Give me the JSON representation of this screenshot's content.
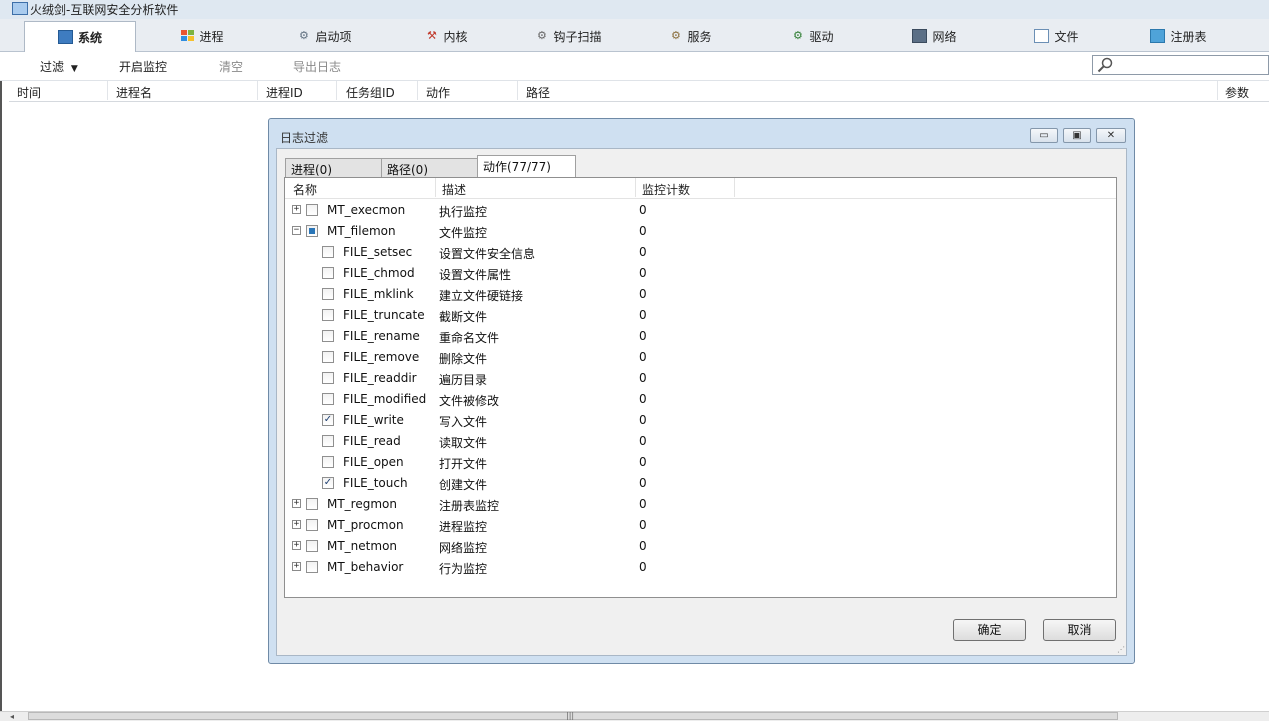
{
  "window": {
    "title": "火绒剑-互联网安全分析软件"
  },
  "tabs": [
    {
      "label": "系统",
      "icon": "monitor-icon",
      "active": true
    },
    {
      "label": "进程",
      "icon": "windows-flag-icon"
    },
    {
      "label": "启动项",
      "icon": "gear-icon"
    },
    {
      "label": "内核",
      "icon": "kernel-tool-icon"
    },
    {
      "label": "钩子扫描",
      "icon": "hook-scan-icon"
    },
    {
      "label": "服务",
      "icon": "service-gear-icon"
    },
    {
      "label": "驱动",
      "icon": "driver-icon"
    },
    {
      "label": "网络",
      "icon": "network-icon"
    },
    {
      "label": "文件",
      "icon": "file-icon"
    },
    {
      "label": "注册表",
      "icon": "registry-icon"
    }
  ],
  "toolbar": {
    "filter": "过滤",
    "filter_arrow": "▼",
    "start_monitor": "开启监控",
    "clear": "清空",
    "export_log": "导出日志",
    "search_value": ""
  },
  "columns": [
    "时间",
    "进程名",
    "进程ID",
    "任务组ID",
    "动作",
    "路径",
    "参数"
  ],
  "dialog": {
    "title": "日志过滤",
    "tabs": [
      "进程(0)",
      "路径(0)",
      "动作(77/77)"
    ],
    "tree_headers": [
      "名称",
      "描述",
      "监控计数"
    ],
    "rows": [
      {
        "name": "MT_execmon",
        "desc": "执行监控",
        "count": "0",
        "level": 0,
        "expander": "+",
        "check": ""
      },
      {
        "name": "MT_filemon",
        "desc": "文件监控",
        "count": "0",
        "level": 0,
        "expander": "-",
        "check": "partial"
      },
      {
        "name": "FILE_setsec",
        "desc": "设置文件安全信息",
        "count": "0",
        "level": 1,
        "check": ""
      },
      {
        "name": "FILE_chmod",
        "desc": "设置文件属性",
        "count": "0",
        "level": 1,
        "check": ""
      },
      {
        "name": "FILE_mklink",
        "desc": "建立文件硬链接",
        "count": "0",
        "level": 1,
        "check": ""
      },
      {
        "name": "FILE_truncate",
        "desc": "截断文件",
        "count": "0",
        "level": 1,
        "check": ""
      },
      {
        "name": "FILE_rename",
        "desc": "重命名文件",
        "count": "0",
        "level": 1,
        "check": ""
      },
      {
        "name": "FILE_remove",
        "desc": "删除文件",
        "count": "0",
        "level": 1,
        "check": ""
      },
      {
        "name": "FILE_readdir",
        "desc": "遍历目录",
        "count": "0",
        "level": 1,
        "check": ""
      },
      {
        "name": "FILE_modified",
        "desc": "文件被修改",
        "count": "0",
        "level": 1,
        "check": ""
      },
      {
        "name": "FILE_write",
        "desc": "写入文件",
        "count": "0",
        "level": 1,
        "check": "✓"
      },
      {
        "name": "FILE_read",
        "desc": "读取文件",
        "count": "0",
        "level": 1,
        "check": ""
      },
      {
        "name": "FILE_open",
        "desc": "打开文件",
        "count": "0",
        "level": 1,
        "check": ""
      },
      {
        "name": "FILE_touch",
        "desc": "创建文件",
        "count": "0",
        "level": 1,
        "check": "✓"
      },
      {
        "name": "MT_regmon",
        "desc": "注册表监控",
        "count": "0",
        "level": 0,
        "expander": "+",
        "check": ""
      },
      {
        "name": "MT_procmon",
        "desc": "进程监控",
        "count": "0",
        "level": 0,
        "expander": "+",
        "check": ""
      },
      {
        "name": "MT_netmon",
        "desc": "网络监控",
        "count": "0",
        "level": 0,
        "expander": "+",
        "check": ""
      },
      {
        "name": "MT_behavior",
        "desc": "行为监控",
        "count": "0",
        "level": 0,
        "expander": "+",
        "check": ""
      }
    ],
    "ok": "确定",
    "cancel": "取消"
  }
}
